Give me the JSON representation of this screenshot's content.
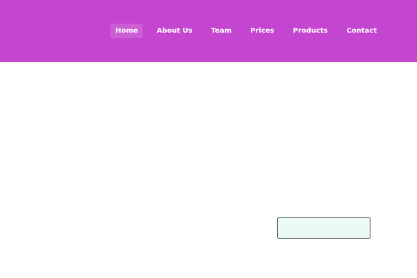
{
  "header": {
    "background_color": "#c445d0",
    "nav": {
      "items": [
        {
          "label": "Home",
          "active": true
        },
        {
          "label": "About Us",
          "active": false
        },
        {
          "label": "Team",
          "active": false
        },
        {
          "label": "Prices",
          "active": false
        },
        {
          "label": "Products",
          "active": false
        },
        {
          "label": "Contact",
          "active": false
        }
      ]
    }
  },
  "cta_button": {
    "background_color": "#ebfbf4",
    "border_color": "#3a3f44"
  }
}
